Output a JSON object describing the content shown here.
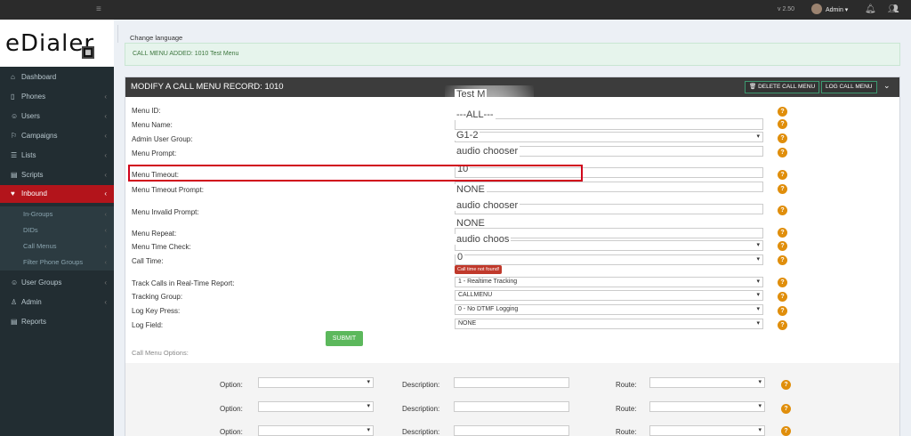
{
  "topbar": {
    "version": "v 2.50",
    "user": "Admin",
    "icons": [
      "menu-icon",
      "bell-icon",
      "users-icon"
    ]
  },
  "logo": {
    "text": "eDialer",
    "box_glyph": "▦"
  },
  "sidebar": {
    "items": [
      {
        "label": "Dashboard",
        "icon": "home-icon"
      },
      {
        "label": "Phones",
        "icon": "phone-icon"
      },
      {
        "label": "Users",
        "icon": "user-icon"
      },
      {
        "label": "Campaigns",
        "icon": "flag-icon"
      },
      {
        "label": "Lists",
        "icon": "list-icon"
      },
      {
        "label": "Scripts",
        "icon": "file-icon"
      },
      {
        "label": "Inbound",
        "icon": "inbound-icon"
      },
      {
        "label": "User Groups",
        "icon": "user-group-icon"
      },
      {
        "label": "Admin",
        "icon": "admin-icon"
      },
      {
        "label": "Reports",
        "icon": "report-icon"
      }
    ],
    "sub_items": [
      "In-Groups",
      "DIDs",
      "Call Menus",
      "Filter Phone Groups"
    ]
  },
  "main": {
    "change_language": "Change language",
    "alert": "CALL MENU ADDED: 1010 Test Menu",
    "panel_title": "MODIFY A CALL MENU RECORD: 1010",
    "delete_btn": "DELETE CALL MENU",
    "log_btn": "LOG CALL MENU",
    "submit": "SUBMIT",
    "options_title": "Call Menu Options:",
    "error_badge": "Call time not found!"
  },
  "form": {
    "labels": {
      "menu_id": "Menu ID:",
      "menu_name": "Menu Name:",
      "admin_group": "Admin User Group:",
      "menu_prompt": "Menu Prompt:",
      "menu_timeout": "Menu Timeout:",
      "timeout_prompt": "Menu Timeout Prompt:",
      "invalid_prompt": "Menu Invalid Prompt:",
      "menu_repeat": "Menu Repeat:",
      "time_check": "Menu Time Check:",
      "call_time": "Call Time:",
      "track_calls": "Track Calls in Real-Time Report:",
      "tracking_group": "Tracking Group:",
      "log_key": "Log Key Press:",
      "log_field": "Log Field:"
    },
    "values": {
      "menu_name": "Test M",
      "admin_group_top": "---ALL---",
      "admin_group": "G1-2",
      "menu_prompt": "audio chooser",
      "menu_timeout": "10",
      "timeout_prompt": "NONE",
      "invalid_prompt": "audio chooser",
      "menu_repeat": "NONE",
      "time_check": "audio choos",
      "call_time": "0",
      "track_calls": "1 - Realtime Tracking",
      "tracking_group": "CALLMENU",
      "log_key": "0 - No DTMF Logging",
      "log_field": "NONE"
    }
  },
  "options": {
    "option_label": "Option:",
    "description_label": "Description:",
    "route_label": "Route:",
    "rows": [
      1,
      2,
      3
    ]
  },
  "help_glyph": "?",
  "colors": {
    "active_nav": "#b3141b",
    "help_badge": "#e08e0b",
    "submit": "#5cb85c",
    "highlight": "#d0021b"
  }
}
